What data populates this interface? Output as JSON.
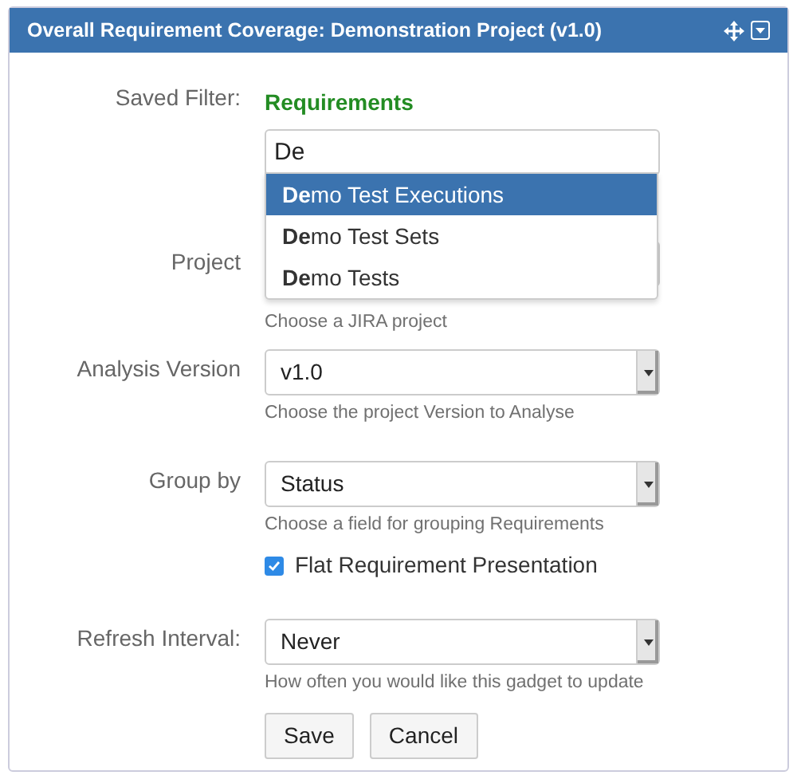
{
  "header": {
    "title": "Overall Requirement Coverage: Demonstration Project (v1.0)"
  },
  "saved_filter": {
    "label": "Saved Filter:",
    "current": "Requirements",
    "value": "De",
    "suggestions": [
      {
        "label": "**De**mo Test Executions",
        "selected": true
      },
      {
        "label": "**De**mo Test Sets",
        "selected": false
      },
      {
        "label": "**De**mo Tests",
        "selected": false
      }
    ]
  },
  "fields": [
    {
      "kind": "select",
      "label": "Project",
      "hint": "Choose a JIRA project"
    },
    {
      "kind": "select",
      "label": "Analysis Version",
      "value": "v1.0",
      "hint": "Choose the project Version to Analyse"
    },
    {
      "kind": "select",
      "label": "Group by",
      "value": "Status",
      "hint": "Choose a field for grouping Requirements"
    },
    {
      "kind": "checkbox",
      "label": "Flat Requirement Presentation",
      "checked": true
    },
    {
      "kind": "select",
      "label": "Refresh Interval:",
      "value": "Never",
      "hint": "How often you would like this gadget to update"
    }
  ],
  "buttons": [
    "Save",
    "Cancel"
  ]
}
